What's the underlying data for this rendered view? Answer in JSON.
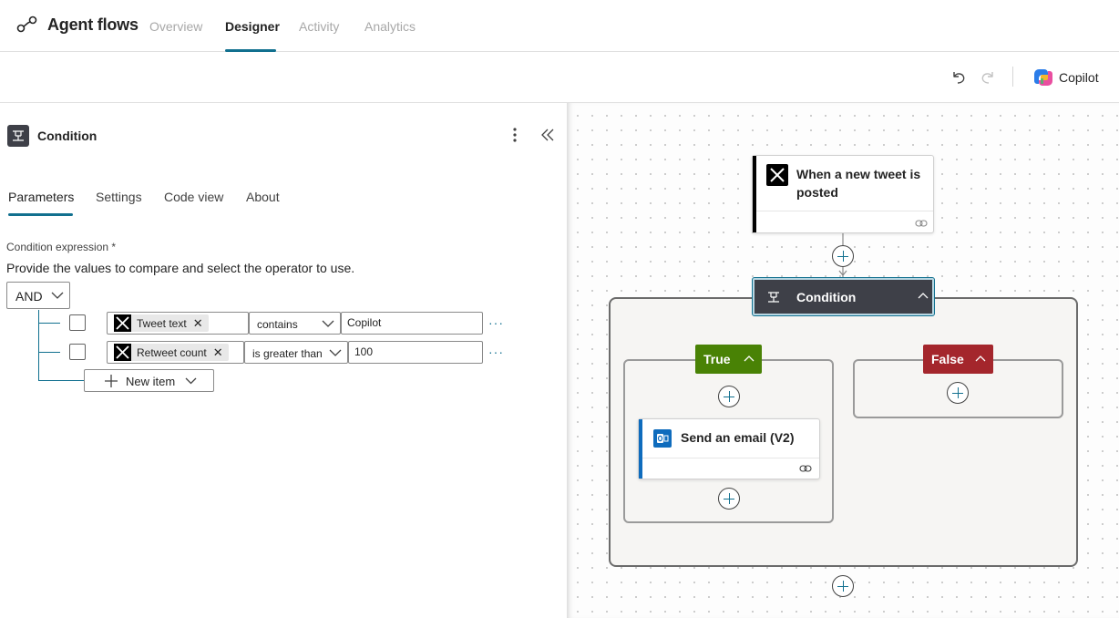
{
  "app": {
    "title": "Agent flows",
    "tabs": [
      {
        "label": "Overview",
        "active": false
      },
      {
        "label": "Designer",
        "active": true
      },
      {
        "label": "Activity",
        "active": false
      },
      {
        "label": "Analytics",
        "active": false
      }
    ]
  },
  "toolbar": {
    "undo_icon": "undo-icon",
    "redo_icon": "redo-icon",
    "copilot_label": "Copilot"
  },
  "panel": {
    "title": "Condition",
    "tabs": [
      {
        "label": "Parameters",
        "active": true
      },
      {
        "label": "Settings",
        "active": false
      },
      {
        "label": "Code view",
        "active": false
      },
      {
        "label": "About",
        "active": false
      }
    ],
    "expression_label": "Condition expression",
    "required_mark": "*",
    "description": "Provide the values to compare and select the operator to use.",
    "group_operator": "AND",
    "rows": [
      {
        "token": "Tweet text",
        "operator": "contains",
        "value": "Copilot"
      },
      {
        "token": "Retweet count",
        "operator": "is greater than",
        "value": "100"
      }
    ],
    "more_label": "···",
    "new_item_label": "New item"
  },
  "canvas": {
    "trigger_title": "When a new tweet is posted",
    "condition_title": "Condition",
    "true_label": "True",
    "false_label": "False",
    "action_title": "Send an email (V2)"
  },
  "colors": {
    "accent": "#11708f",
    "true_branch": "#498205",
    "false_branch": "#a4262c",
    "condition_node": "#3e4048",
    "outlook_blue": "#0f6cbd"
  }
}
